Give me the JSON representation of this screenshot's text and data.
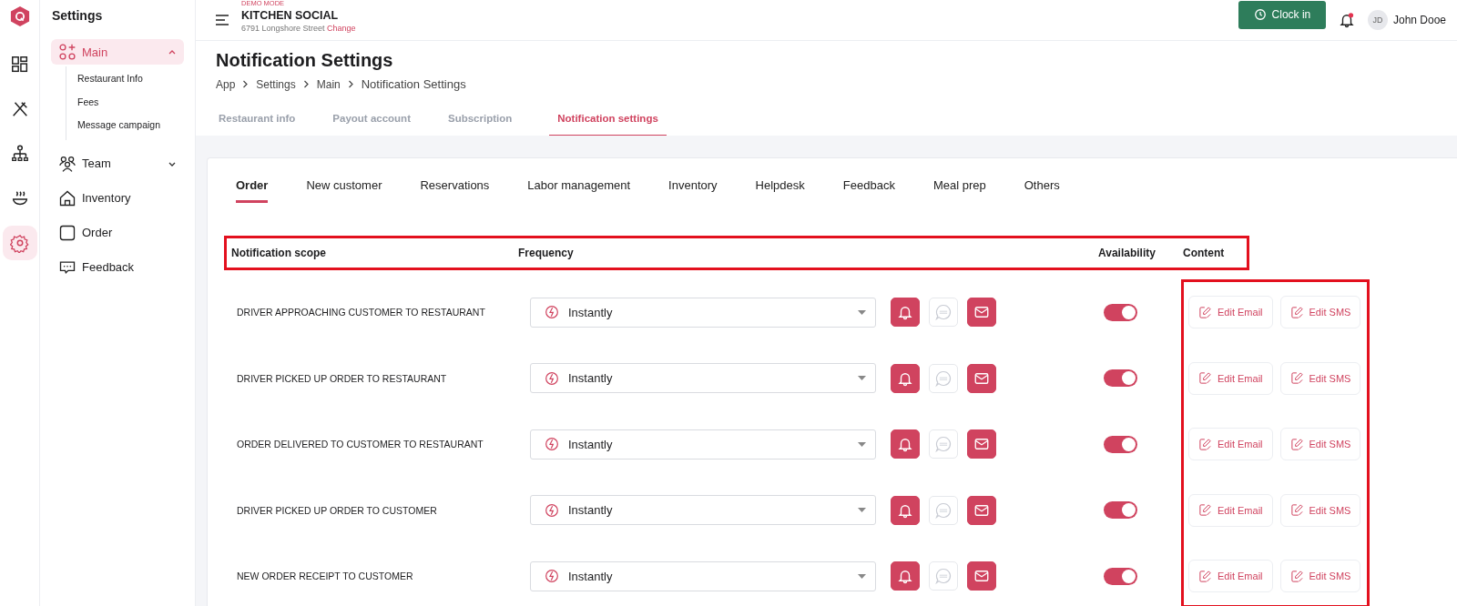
{
  "rail": [
    {
      "kind": "dashboard",
      "selected": false
    },
    {
      "kind": "utensils",
      "selected": false
    },
    {
      "kind": "hierarchy",
      "selected": false
    },
    {
      "kind": "bowl",
      "selected": false
    },
    {
      "kind": "settings",
      "selected": true
    }
  ],
  "sidebar": {
    "title": "Settings",
    "items": [
      {
        "kind": "main",
        "label": "Main",
        "selected": true,
        "expanded": true,
        "children": [
          {
            "label": "Restaurant Info"
          },
          {
            "label": "Fees"
          },
          {
            "label": "Message campaign"
          }
        ]
      },
      {
        "kind": "team",
        "label": "Team",
        "selected": false,
        "expanded": false
      },
      {
        "kind": "inventory",
        "label": "Inventory",
        "selected": false
      },
      {
        "kind": "order",
        "label": "Order",
        "selected": false
      },
      {
        "kind": "feedback",
        "label": "Feedback",
        "selected": false
      }
    ]
  },
  "header": {
    "mode_badge": "DEMO MODE",
    "restaurant": "KITCHEN SOCIAL",
    "address": "6791 Longshore Street",
    "change_link": "Change",
    "clock_button": "Clock in",
    "notifications_unread": true,
    "user_initials": "JD",
    "user_name": "John Dooe"
  },
  "page_title": "Notification Settings",
  "breadcrumb": [
    "App",
    "Settings",
    "Main",
    "Notification Settings"
  ],
  "tabs": [
    {
      "label": "Restaurant info",
      "selected": false
    },
    {
      "label": "Payout account",
      "selected": false
    },
    {
      "label": "Subscription",
      "selected": false
    },
    {
      "label": "Notification settings",
      "selected": true
    }
  ],
  "category_tabs": [
    {
      "label": "Order",
      "selected": true
    },
    {
      "label": "New customer",
      "selected": false
    },
    {
      "label": "Reservations",
      "selected": false
    },
    {
      "label": "Labor management",
      "selected": false
    },
    {
      "label": "Inventory",
      "selected": false
    },
    {
      "label": "Helpdesk",
      "selected": false
    },
    {
      "label": "Feedback",
      "selected": false
    },
    {
      "label": "Meal prep",
      "selected": false
    },
    {
      "label": "Others",
      "selected": false
    }
  ],
  "table": {
    "columns": [
      "Notification scope",
      "Frequency",
      "Availability",
      "Content"
    ],
    "rows": [
      {
        "scope": "DRIVER APPROACHING CUSTOMER TO RESTAURANT",
        "frequency": "Instantly",
        "channels": [
          {
            "kind": "push",
            "on": true
          },
          {
            "kind": "sms",
            "on": false
          },
          {
            "kind": "email",
            "on": true
          }
        ],
        "available": true,
        "actions": [
          "Edit Email",
          "Edit SMS"
        ]
      },
      {
        "scope": "DRIVER PICKED UP ORDER TO RESTAURANT",
        "frequency": "Instantly",
        "channels": [
          {
            "kind": "push",
            "on": true
          },
          {
            "kind": "sms",
            "on": false
          },
          {
            "kind": "email",
            "on": true
          }
        ],
        "available": true,
        "actions": [
          "Edit Email",
          "Edit SMS"
        ]
      },
      {
        "scope": "ORDER DELIVERED TO CUSTOMER TO RESTAURANT",
        "frequency": "Instantly",
        "channels": [
          {
            "kind": "push",
            "on": true
          },
          {
            "kind": "sms",
            "on": false
          },
          {
            "kind": "email",
            "on": true
          }
        ],
        "available": true,
        "actions": [
          "Edit Email",
          "Edit SMS"
        ]
      },
      {
        "scope": "DRIVER PICKED UP ORDER TO CUSTOMER",
        "frequency": "Instantly",
        "channels": [
          {
            "kind": "push",
            "on": true
          },
          {
            "kind": "sms",
            "on": false
          },
          {
            "kind": "email",
            "on": true
          }
        ],
        "available": true,
        "actions": [
          "Edit Email",
          "Edit SMS"
        ]
      },
      {
        "scope": "NEW ORDER RECEIPT TO CUSTOMER",
        "frequency": "Instantly",
        "channels": [
          {
            "kind": "push",
            "on": true
          },
          {
            "kind": "sms",
            "on": false
          },
          {
            "kind": "email",
            "on": true
          }
        ],
        "available": true,
        "actions": [
          "Edit Email",
          "Edit SMS"
        ]
      }
    ]
  }
}
